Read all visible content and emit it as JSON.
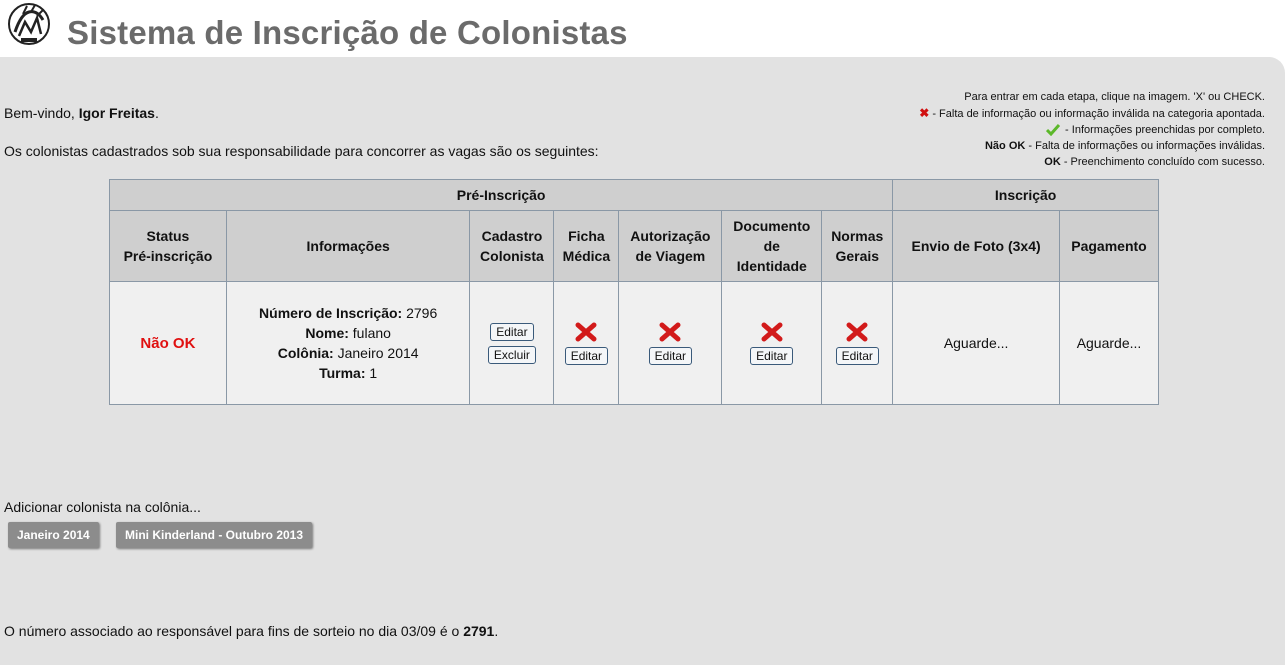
{
  "header": {
    "title": "Sistema de Inscrição de Colonistas"
  },
  "legend": {
    "line1": "Para entrar em cada etapa, clique na imagem. 'X' ou CHECK.",
    "line2": " - Falta de informação ou informação inválida na categoria apontada.",
    "line3": " - Informações preenchidas por completo.",
    "line4_label": "Não OK",
    "line4_text": " - Falta de informações ou informações inválidas.",
    "line5_label": "OK",
    "line5_text": " - Preenchimento concluído com sucesso."
  },
  "welcome": {
    "prefix": "Bem-vindo, ",
    "user": "Igor Freitas",
    "suffix": "."
  },
  "intro": "Os colonistas cadastrados sob sua responsabilidade para concorrer as vagas são os seguintes:",
  "table": {
    "group_pre": "Pré-Inscrição",
    "group_insc": "Inscrição",
    "headers": {
      "status": [
        "Status",
        "Pré-inscrição"
      ],
      "info": "Informações",
      "cadastro": [
        "Cadastro",
        "Colonista"
      ],
      "ficha": [
        "Ficha",
        "Médica"
      ],
      "autorizacao": [
        "Autorização",
        "de Viagem"
      ],
      "documento": [
        "Documento",
        "de",
        "Identidade"
      ],
      "normas": [
        "Normas",
        "Gerais"
      ],
      "foto": "Envio de Foto (3x4)",
      "pagamento": "Pagamento"
    },
    "row": {
      "status": "Não OK",
      "numero_label": "Número de Inscrição:",
      "numero": " 2796",
      "nome_label": "Nome:",
      "nome": " fulano",
      "colonia_label": "Colônia:",
      "colonia": " Janeiro 2014",
      "turma_label": "Turma:",
      "turma": " 1",
      "edit_label": "Editar",
      "delete_label": "Excluir",
      "foto": "Aguarde...",
      "pagamento": "Aguarde..."
    }
  },
  "add_colonist": {
    "label": "Adicionar colonista na colônia...",
    "options": [
      "Janeiro 2014",
      "Mini Kinderland - Outubro 2013"
    ]
  },
  "footer": {
    "text": "O número associado ao responsável para fins de sorteio no dia 03/09 é o ",
    "number": "2791",
    "suffix": "."
  },
  "colors": {
    "error_red": "#e01010",
    "title_gray": "#6b6b6b",
    "panel_bg": "#e2e2e2"
  },
  "icons": {
    "invalid": "x-icon",
    "complete": "check-icon"
  }
}
